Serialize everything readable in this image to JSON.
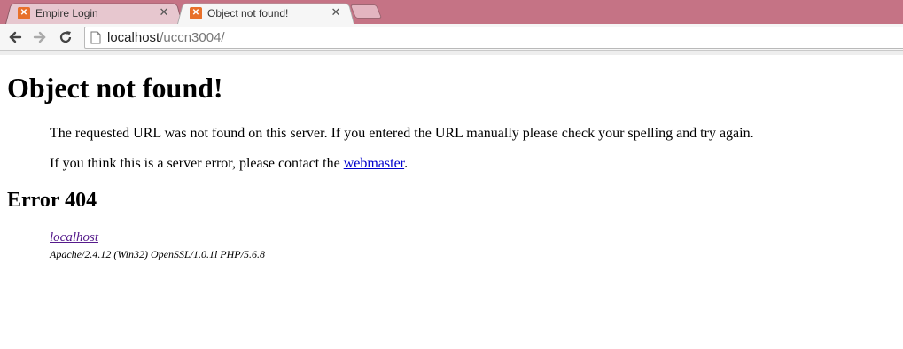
{
  "tabs": [
    {
      "title": "Empire Login",
      "active": false
    },
    {
      "title": "Object not found!",
      "active": true
    }
  ],
  "address_bar": {
    "host": "localhost",
    "path": "/uccn3004/"
  },
  "page": {
    "heading": "Object not found!",
    "paragraph1": "The requested URL was not found on this server. If you entered the URL manually please check your spelling and try again.",
    "paragraph2_before": "If you think this is a server error, please contact the ",
    "paragraph2_link": "webmaster",
    "paragraph2_after": ".",
    "error_heading": "Error 404",
    "address_link": "localhost",
    "server_signature": "Apache/2.4.12 (Win32) OpenSSL/1.0.1l PHP/5.6.8"
  },
  "colors": {
    "tabstrip": "#c57385",
    "favicon": "#e8702a",
    "link": "#0000cc",
    "visited_link": "#551a8b"
  }
}
